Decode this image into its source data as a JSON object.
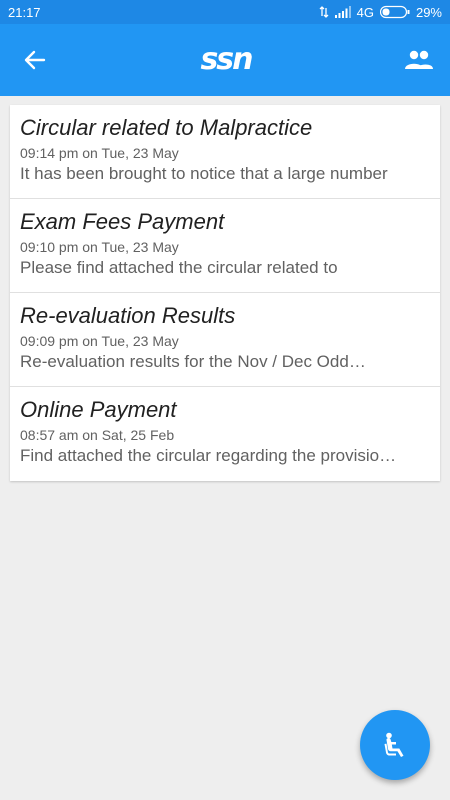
{
  "status_bar": {
    "time": "21:17",
    "network": "4G",
    "battery": "29%"
  },
  "app_bar": {
    "logo_text": "ssn",
    "back_icon": "arrow-back-icon",
    "people_icon": "people-icon",
    "background": "#2196f3"
  },
  "circulars": [
    {
      "title": "Circular related to Malpractice",
      "date": "09:14 pm on Tue, 23 May",
      "snippet": "It has been brought to notice that a large number"
    },
    {
      "title": "Exam Fees Payment",
      "date": "09:10 pm on Tue, 23 May",
      "snippet": "Please find attached the circular related to"
    },
    {
      "title": "Re-evaluation Results",
      "date": "09:09 pm on Tue, 23 May",
      "snippet": "Re-evaluation results for the Nov / Dec Odd…"
    },
    {
      "title": "Online Payment",
      "date": "08:57 am on Sat, 25 Feb",
      "snippet": "Find attached the circular regarding the provisio…"
    }
  ],
  "fab": {
    "icon": "seat-recline-icon",
    "color": "#2196f3"
  }
}
